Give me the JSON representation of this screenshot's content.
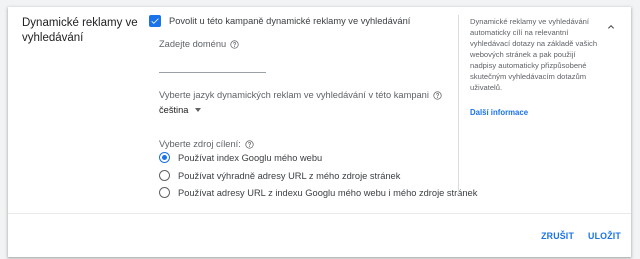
{
  "section": {
    "title": "Dynamické reklamy ve vyhledávání"
  },
  "checkbox": {
    "label": "Povolit u této kampaně dynamické reklamy ve vyhledávání",
    "checked": true
  },
  "domain": {
    "label": "Zadejte doménu",
    "value": ""
  },
  "language": {
    "label": "Vyberte jazyk dynamických reklam ve vyhledávání v této kampani",
    "selected": "čeština"
  },
  "targeting": {
    "label": "Vyberte zdroj cílení:",
    "options": [
      {
        "label": "Používat index Googlu mého webu",
        "selected": true
      },
      {
        "label": "Používat výhradně adresy URL z mého zdroje stránek",
        "selected": false
      },
      {
        "label": "Používat adresy URL z indexu Googlu mého webu i mého zdroje stránek",
        "selected": false
      }
    ]
  },
  "help": {
    "text": "Dynamické reklamy ve vyhledávání automaticky cílí na relevantní vyhledávací dotazy na základě vašich webových stránek a pak použijí nadpisy automaticky přizpůsobené skutečným vyhledávacím dotazům uživatelů.",
    "learn_more": "Další informace"
  },
  "actions": {
    "cancel": "ZRUŠIT",
    "save": "ULOŽIT"
  },
  "colors": {
    "accent": "#1a73e8",
    "background": "#f1f3f4"
  }
}
